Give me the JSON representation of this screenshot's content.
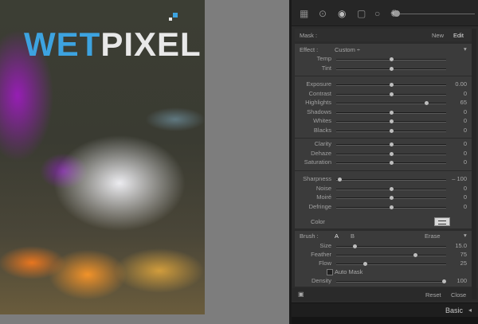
{
  "photo": {
    "logo_part1": "WET",
    "logo_part2": "PIXEL"
  },
  "toolbar": {
    "tools": [
      "grid-tool",
      "crop-circle-tool",
      "spot-tool",
      "redeye-tool",
      "graduated-filter-tool",
      "radial-filter-tool",
      "brush-tool"
    ]
  },
  "mask": {
    "label": "Mask :",
    "new": "New",
    "edit": "Edit"
  },
  "effect": {
    "label": "Effect :",
    "value": "Custom ÷",
    "collapse": "▾"
  },
  "groups": [
    [
      {
        "label": "Temp",
        "value": "",
        "pos": 0.5
      },
      {
        "label": "Tint",
        "value": "",
        "pos": 0.5
      }
    ],
    [
      {
        "label": "Exposure",
        "value": "0.00",
        "pos": 0.5
      },
      {
        "label": "Contrast",
        "value": "0",
        "pos": 0.5
      },
      {
        "label": "Highlights",
        "value": "65",
        "pos": 0.82
      },
      {
        "label": "Shadows",
        "value": "0",
        "pos": 0.5
      },
      {
        "label": "Whites",
        "value": "0",
        "pos": 0.5
      },
      {
        "label": "Blacks",
        "value": "0",
        "pos": 0.5
      }
    ],
    [
      {
        "label": "Clarity",
        "value": "0",
        "pos": 0.5
      },
      {
        "label": "Dehaze",
        "value": "0",
        "pos": 0.5
      },
      {
        "label": "Saturation",
        "value": "0",
        "pos": 0.5
      }
    ],
    [
      {
        "label": "Sharpness",
        "value": "– 100",
        "pos": 0.03
      },
      {
        "label": "Noise",
        "value": "0",
        "pos": 0.5
      },
      {
        "label": "Moiré",
        "value": "0",
        "pos": 0.5
      },
      {
        "label": "Defringe",
        "value": "0",
        "pos": 0.5
      }
    ]
  ],
  "color": {
    "label": "Color"
  },
  "brush": {
    "label": "Brush :",
    "a": "A",
    "b": "B",
    "erase": "Erase",
    "collapse": "▾",
    "sliders": [
      {
        "label": "Size",
        "value": "15.0",
        "pos": 0.17
      },
      {
        "label": "Feather",
        "value": "75",
        "pos": 0.72
      },
      {
        "label": "Flow",
        "value": "25",
        "pos": 0.26
      }
    ],
    "auto_mask": "Auto Mask",
    "density": {
      "label": "Density",
      "value": "100",
      "pos": 0.98
    }
  },
  "footer": {
    "reset": "Reset",
    "close": "Close"
  },
  "basic": {
    "label": "Basic",
    "arrow": "◂"
  }
}
